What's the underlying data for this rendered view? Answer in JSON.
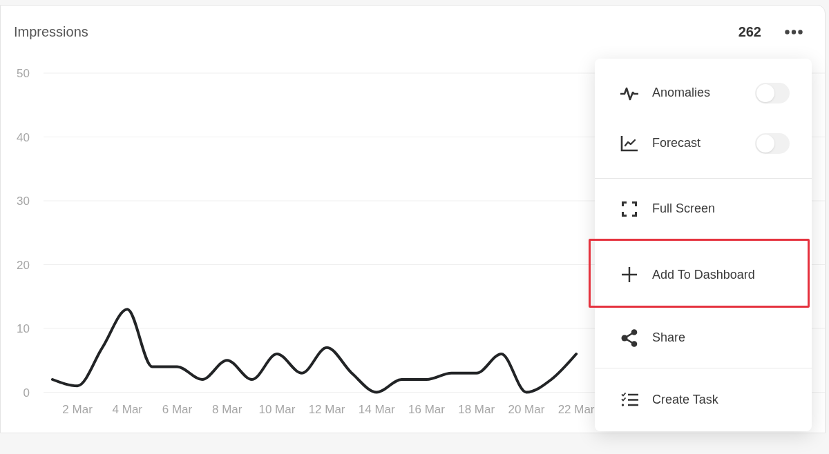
{
  "card": {
    "title": "Impressions",
    "total": "262",
    "chart_data": {
      "type": "line",
      "categories": [
        null,
        "2 Mar",
        null,
        "4 Mar",
        null,
        "6 Mar",
        null,
        "8 Mar",
        null,
        "10 Mar",
        null,
        "12 Mar",
        null,
        "14 Mar",
        null,
        "16 Mar",
        null,
        "18 Mar",
        null,
        "20 Mar",
        null,
        "22 Mar",
        null
      ],
      "values": [
        2,
        1,
        7,
        13,
        4,
        4,
        2,
        5,
        2,
        6,
        3,
        7,
        3,
        0,
        2,
        2,
        3,
        3,
        6,
        0,
        2,
        6,
        null
      ],
      "ylim": [
        0,
        50
      ],
      "yticks": [
        0,
        10,
        20,
        30,
        40,
        50
      ],
      "grid": true
    }
  },
  "menu": {
    "sections": [
      {
        "items": [
          {
            "kind": "toggle",
            "label": "Anomalies",
            "on": false,
            "highlighted": false
          },
          {
            "kind": "toggle",
            "label": "Forecast",
            "on": false,
            "highlighted": false
          }
        ]
      },
      {
        "items": [
          {
            "kind": "action",
            "label": "Full Screen",
            "highlighted": false
          },
          {
            "kind": "action",
            "label": "Add To Dashboard",
            "highlighted": true
          },
          {
            "kind": "action",
            "label": "Share",
            "highlighted": false
          }
        ]
      },
      {
        "items": [
          {
            "kind": "action",
            "label": "Create Task",
            "highlighted": false
          }
        ]
      }
    ]
  }
}
